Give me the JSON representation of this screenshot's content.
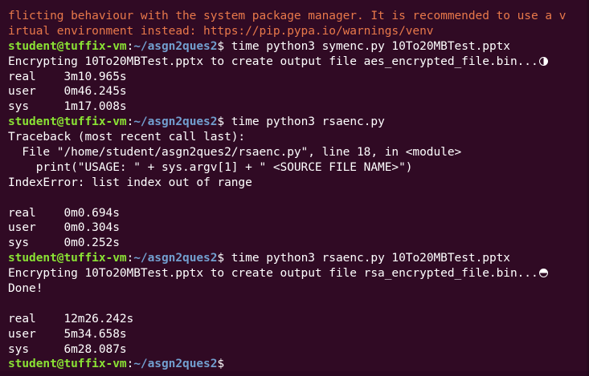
{
  "prompt": {
    "user_host": "student@tuffix-vm",
    "colon": ":",
    "cwd": "~/asgn2ques2",
    "dollar": "$"
  },
  "lines": {
    "l0": "flicting behaviour with the system package manager. It is recommended to use a v",
    "l1": "irtual environment instead: https://pip.pypa.io/warnings/venv",
    "cmd1": " time python3 symenc.py 10To20MBTest.pptx",
    "l3": "Encrypting 10To20MBTest.pptx to create output file aes_encrypted_file.bin...",
    "l4": "real    3m10.965s",
    "l5": "user    0m46.245s",
    "l6": "sys     1m17.008s",
    "cmd2": " time python3 rsaenc.py",
    "l8": "Traceback (most recent call last):",
    "l9": "  File \"/home/student/asgn2ques2/rsaenc.py\", line 18, in <module>",
    "l10": "    print(\"USAGE: \" + sys.argv[1] + \" <SOURCE FILE NAME>\")",
    "l11": "IndexError: list index out of range",
    "l13": "real    0m0.694s",
    "l14": "user    0m0.304s",
    "l15": "sys     0m0.252s",
    "cmd3": " time python3 rsaenc.py 10To20MBTest.pptx",
    "l17": "Encrypting 10To20MBTest.pptx to create output file rsa_encrypted_file.bin...",
    "l18": "Done!",
    "l20": "real    12m26.242s",
    "l21": "user    5m34.658s",
    "l22": "sys     6m28.087s"
  },
  "colors": {
    "background": "#300a24",
    "prompt_user": "#8ae234",
    "prompt_path": "#729fcf",
    "warning_text": "#e8784a",
    "text": "#ffffff"
  },
  "icons": {
    "spinner1": "spinner-half-right-icon",
    "spinner2": "spinner-half-top-icon"
  }
}
